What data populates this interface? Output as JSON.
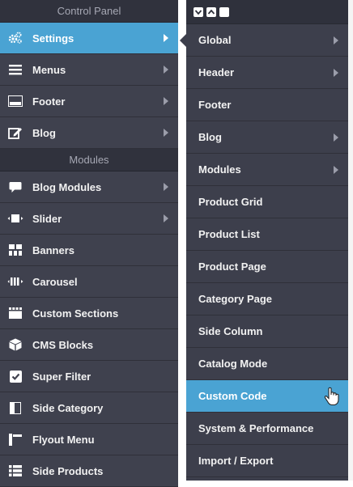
{
  "control_panel": {
    "header": "Control Panel",
    "settings_items": [
      {
        "label": "Settings",
        "icon": "cogs-icon",
        "has_submenu": true,
        "active": true
      },
      {
        "label": "Menus",
        "icon": "menu-lines-icon",
        "has_submenu": true
      },
      {
        "label": "Footer",
        "icon": "footer-icon",
        "has_submenu": true
      },
      {
        "label": "Blog",
        "icon": "edit-icon",
        "has_submenu": true
      }
    ],
    "modules_header": "Modules",
    "module_items": [
      {
        "label": "Blog Modules",
        "icon": "comment-icon",
        "has_submenu": true
      },
      {
        "label": "Slider",
        "icon": "slider-icon",
        "has_submenu": true
      },
      {
        "label": "Banners",
        "icon": "banners-grid-icon"
      },
      {
        "label": "Carousel",
        "icon": "carousel-icon"
      },
      {
        "label": "Custom Sections",
        "icon": "sections-icon"
      },
      {
        "label": "CMS Blocks",
        "icon": "cube-icon"
      },
      {
        "label": "Super Filter",
        "icon": "checkbox-icon"
      },
      {
        "label": "Side Category",
        "icon": "side-category-icon"
      },
      {
        "label": "Flyout Menu",
        "icon": "flyout-menu-icon"
      },
      {
        "label": "Side Products",
        "icon": "list-icon"
      }
    ]
  },
  "submenu": {
    "items": [
      {
        "label": "Global",
        "has_submenu": true
      },
      {
        "label": "Header",
        "has_submenu": true
      },
      {
        "label": "Footer"
      },
      {
        "label": "Blog",
        "has_submenu": true
      },
      {
        "label": "Modules",
        "has_submenu": true
      },
      {
        "label": "Product Grid"
      },
      {
        "label": "Product List"
      },
      {
        "label": "Product Page"
      },
      {
        "label": "Category Page"
      },
      {
        "label": "Side Column"
      },
      {
        "label": "Catalog Mode"
      },
      {
        "label": "Custom Code",
        "active": true
      },
      {
        "label": "System & Performance"
      },
      {
        "label": "Import / Export"
      }
    ]
  },
  "colors": {
    "accent": "#4aa3d3",
    "panel": "#3d3f4c"
  }
}
